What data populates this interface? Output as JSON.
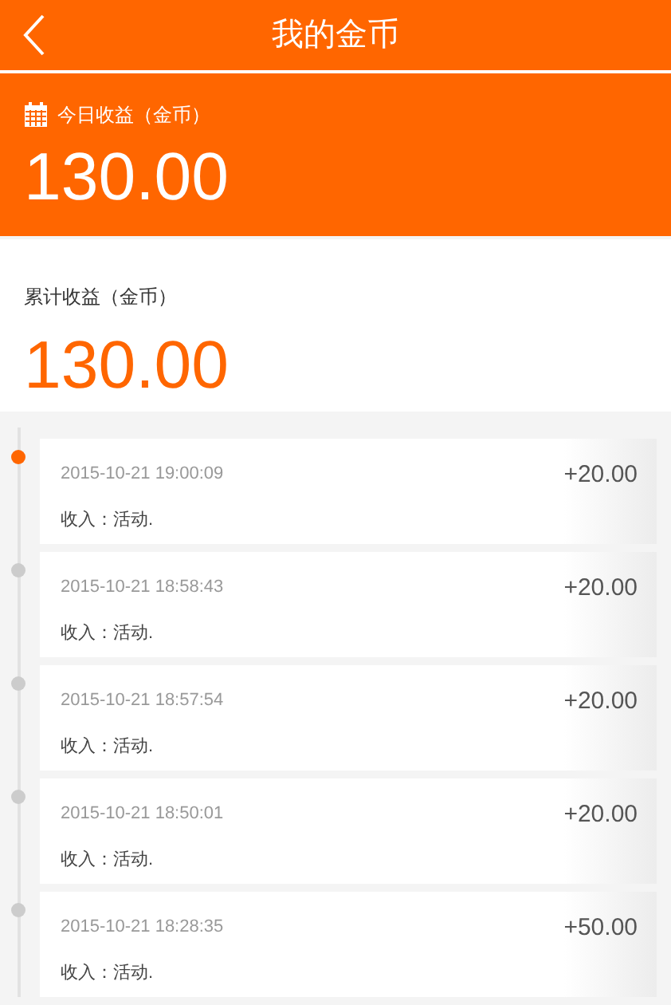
{
  "header": {
    "title": "我的金币"
  },
  "today": {
    "label": "今日收益（金币）",
    "amount": "130.00"
  },
  "total": {
    "label": "累计收益（金币）",
    "amount": "130.00"
  },
  "records": [
    {
      "time": "2015-10-21 19:00:09",
      "amount": "+20.00",
      "note": "收入：活动.",
      "current": true
    },
    {
      "time": "2015-10-21 18:58:43",
      "amount": "+20.00",
      "note": "收入：活动.",
      "current": false
    },
    {
      "time": "2015-10-21 18:57:54",
      "amount": "+20.00",
      "note": "收入：活动.",
      "current": false
    },
    {
      "time": "2015-10-21 18:50:01",
      "amount": "+20.00",
      "note": "收入：活动.",
      "current": false
    },
    {
      "time": "2015-10-21 18:28:35",
      "amount": "+50.00",
      "note": "收入：活动.",
      "current": false
    }
  ]
}
